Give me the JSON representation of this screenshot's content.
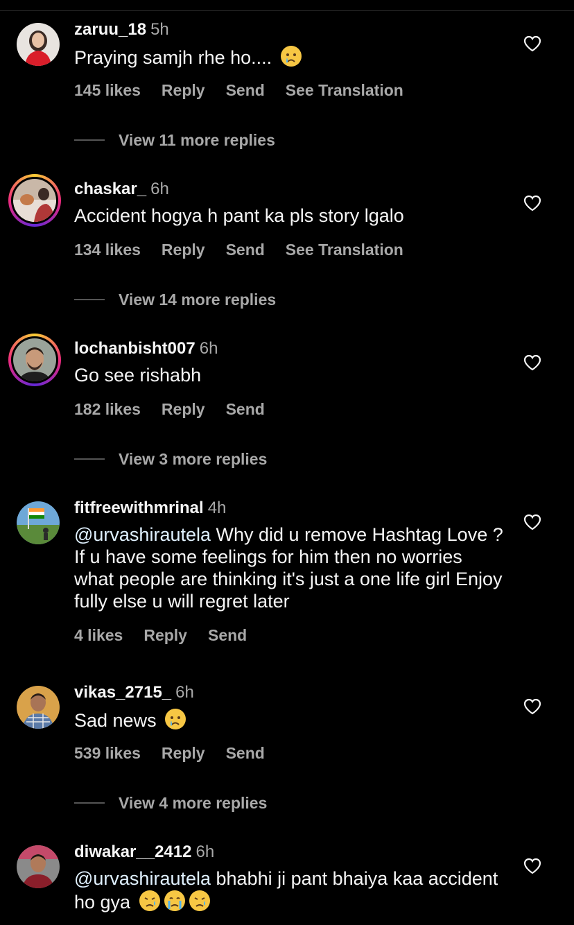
{
  "comments": [
    {
      "username": "zaruu_18",
      "time": "5h",
      "text": "Praying samjh rhe ho....",
      "likes": "145 likes",
      "reply": "Reply",
      "send": "Send",
      "translate": "See Translation",
      "more_replies": "View 11 more replies"
    },
    {
      "username": "chaskar_",
      "time": "6h",
      "text": "Accident hogya h pant ka pls story lgalo",
      "likes": "134 likes",
      "reply": "Reply",
      "send": "Send",
      "translate": "See Translation",
      "more_replies": "View 14 more replies"
    },
    {
      "username": "lochanbisht007",
      "time": "6h",
      "text": "Go see rishabh",
      "likes": "182 likes",
      "reply": "Reply",
      "send": "Send",
      "more_replies": "View 3 more replies"
    },
    {
      "username": "fitfreewithmrinal",
      "time": "4h",
      "mention": "@urvashirautela",
      "text": " Why did u remove Hashtag Love ? If u have some feelings for him then no worries what people are thinking it's just a one life girl Enjoy fully else u will regret later",
      "likes": "4 likes",
      "reply": "Reply",
      "send": "Send"
    },
    {
      "username": "vikas_2715_",
      "time": "6h",
      "text": "Sad news",
      "likes": "539 likes",
      "reply": "Reply",
      "send": "Send",
      "more_replies": "View 4 more replies"
    },
    {
      "username": "diwakar__2412",
      "time": "6h",
      "mention": "@urvashirautela",
      "text": " bhabhi ji pant bhaiya kaa accident ho gya"
    }
  ],
  "colors": {
    "background": "#000000",
    "primary_text": "#f5f5f5",
    "secondary_text": "#a8a8a8",
    "mention": "#e0f1ff",
    "story_ring": [
      "#f9ce34",
      "#ee2a7b",
      "#6228d7"
    ]
  },
  "icons": {
    "like": "heart-outline-icon",
    "crying_emoji": "crying-face-emoji",
    "sad_emoji": "sad-but-relieved-face-emoji"
  }
}
